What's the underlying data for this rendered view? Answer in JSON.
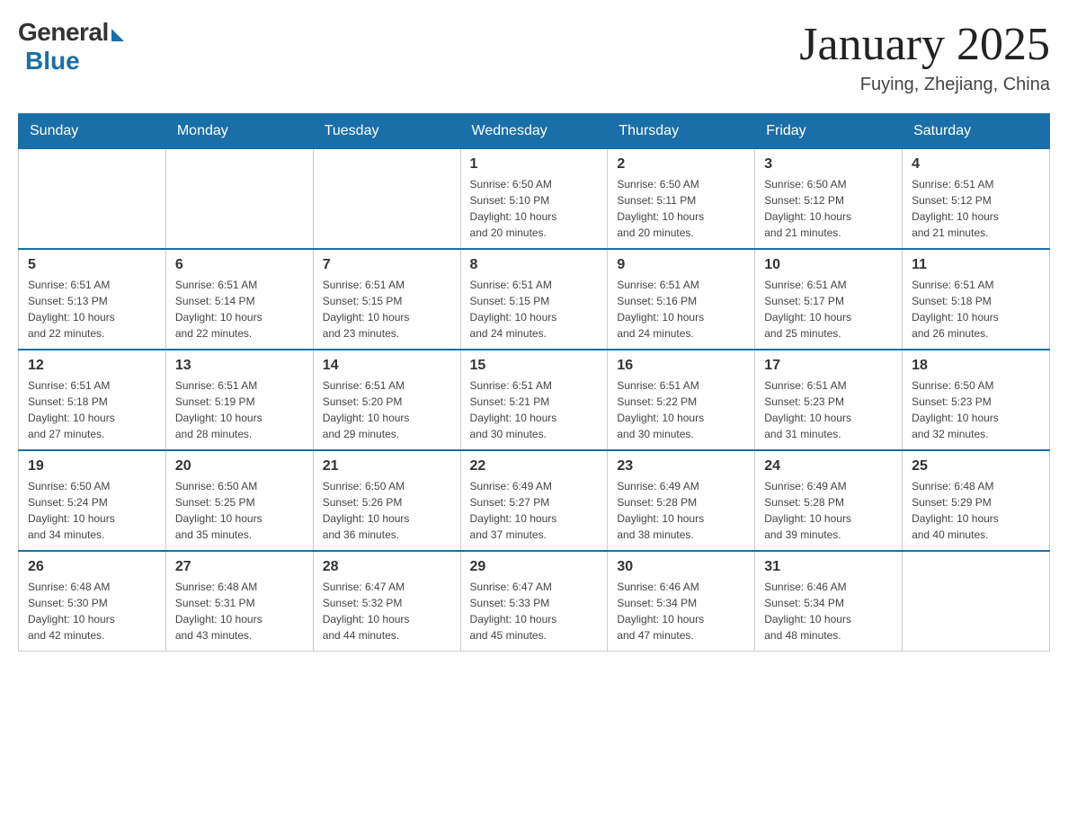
{
  "header": {
    "logo_general": "General",
    "logo_blue": "Blue",
    "title": "January 2025",
    "location": "Fuying, Zhejiang, China"
  },
  "weekdays": [
    "Sunday",
    "Monday",
    "Tuesday",
    "Wednesday",
    "Thursday",
    "Friday",
    "Saturday"
  ],
  "weeks": [
    [
      {
        "day": "",
        "info": ""
      },
      {
        "day": "",
        "info": ""
      },
      {
        "day": "",
        "info": ""
      },
      {
        "day": "1",
        "info": "Sunrise: 6:50 AM\nSunset: 5:10 PM\nDaylight: 10 hours\nand 20 minutes."
      },
      {
        "day": "2",
        "info": "Sunrise: 6:50 AM\nSunset: 5:11 PM\nDaylight: 10 hours\nand 20 minutes."
      },
      {
        "day": "3",
        "info": "Sunrise: 6:50 AM\nSunset: 5:12 PM\nDaylight: 10 hours\nand 21 minutes."
      },
      {
        "day": "4",
        "info": "Sunrise: 6:51 AM\nSunset: 5:12 PM\nDaylight: 10 hours\nand 21 minutes."
      }
    ],
    [
      {
        "day": "5",
        "info": "Sunrise: 6:51 AM\nSunset: 5:13 PM\nDaylight: 10 hours\nand 22 minutes."
      },
      {
        "day": "6",
        "info": "Sunrise: 6:51 AM\nSunset: 5:14 PM\nDaylight: 10 hours\nand 22 minutes."
      },
      {
        "day": "7",
        "info": "Sunrise: 6:51 AM\nSunset: 5:15 PM\nDaylight: 10 hours\nand 23 minutes."
      },
      {
        "day": "8",
        "info": "Sunrise: 6:51 AM\nSunset: 5:15 PM\nDaylight: 10 hours\nand 24 minutes."
      },
      {
        "day": "9",
        "info": "Sunrise: 6:51 AM\nSunset: 5:16 PM\nDaylight: 10 hours\nand 24 minutes."
      },
      {
        "day": "10",
        "info": "Sunrise: 6:51 AM\nSunset: 5:17 PM\nDaylight: 10 hours\nand 25 minutes."
      },
      {
        "day": "11",
        "info": "Sunrise: 6:51 AM\nSunset: 5:18 PM\nDaylight: 10 hours\nand 26 minutes."
      }
    ],
    [
      {
        "day": "12",
        "info": "Sunrise: 6:51 AM\nSunset: 5:18 PM\nDaylight: 10 hours\nand 27 minutes."
      },
      {
        "day": "13",
        "info": "Sunrise: 6:51 AM\nSunset: 5:19 PM\nDaylight: 10 hours\nand 28 minutes."
      },
      {
        "day": "14",
        "info": "Sunrise: 6:51 AM\nSunset: 5:20 PM\nDaylight: 10 hours\nand 29 minutes."
      },
      {
        "day": "15",
        "info": "Sunrise: 6:51 AM\nSunset: 5:21 PM\nDaylight: 10 hours\nand 30 minutes."
      },
      {
        "day": "16",
        "info": "Sunrise: 6:51 AM\nSunset: 5:22 PM\nDaylight: 10 hours\nand 30 minutes."
      },
      {
        "day": "17",
        "info": "Sunrise: 6:51 AM\nSunset: 5:23 PM\nDaylight: 10 hours\nand 31 minutes."
      },
      {
        "day": "18",
        "info": "Sunrise: 6:50 AM\nSunset: 5:23 PM\nDaylight: 10 hours\nand 32 minutes."
      }
    ],
    [
      {
        "day": "19",
        "info": "Sunrise: 6:50 AM\nSunset: 5:24 PM\nDaylight: 10 hours\nand 34 minutes."
      },
      {
        "day": "20",
        "info": "Sunrise: 6:50 AM\nSunset: 5:25 PM\nDaylight: 10 hours\nand 35 minutes."
      },
      {
        "day": "21",
        "info": "Sunrise: 6:50 AM\nSunset: 5:26 PM\nDaylight: 10 hours\nand 36 minutes."
      },
      {
        "day": "22",
        "info": "Sunrise: 6:49 AM\nSunset: 5:27 PM\nDaylight: 10 hours\nand 37 minutes."
      },
      {
        "day": "23",
        "info": "Sunrise: 6:49 AM\nSunset: 5:28 PM\nDaylight: 10 hours\nand 38 minutes."
      },
      {
        "day": "24",
        "info": "Sunrise: 6:49 AM\nSunset: 5:28 PM\nDaylight: 10 hours\nand 39 minutes."
      },
      {
        "day": "25",
        "info": "Sunrise: 6:48 AM\nSunset: 5:29 PM\nDaylight: 10 hours\nand 40 minutes."
      }
    ],
    [
      {
        "day": "26",
        "info": "Sunrise: 6:48 AM\nSunset: 5:30 PM\nDaylight: 10 hours\nand 42 minutes."
      },
      {
        "day": "27",
        "info": "Sunrise: 6:48 AM\nSunset: 5:31 PM\nDaylight: 10 hours\nand 43 minutes."
      },
      {
        "day": "28",
        "info": "Sunrise: 6:47 AM\nSunset: 5:32 PM\nDaylight: 10 hours\nand 44 minutes."
      },
      {
        "day": "29",
        "info": "Sunrise: 6:47 AM\nSunset: 5:33 PM\nDaylight: 10 hours\nand 45 minutes."
      },
      {
        "day": "30",
        "info": "Sunrise: 6:46 AM\nSunset: 5:34 PM\nDaylight: 10 hours\nand 47 minutes."
      },
      {
        "day": "31",
        "info": "Sunrise: 6:46 AM\nSunset: 5:34 PM\nDaylight: 10 hours\nand 48 minutes."
      },
      {
        "day": "",
        "info": ""
      }
    ]
  ]
}
